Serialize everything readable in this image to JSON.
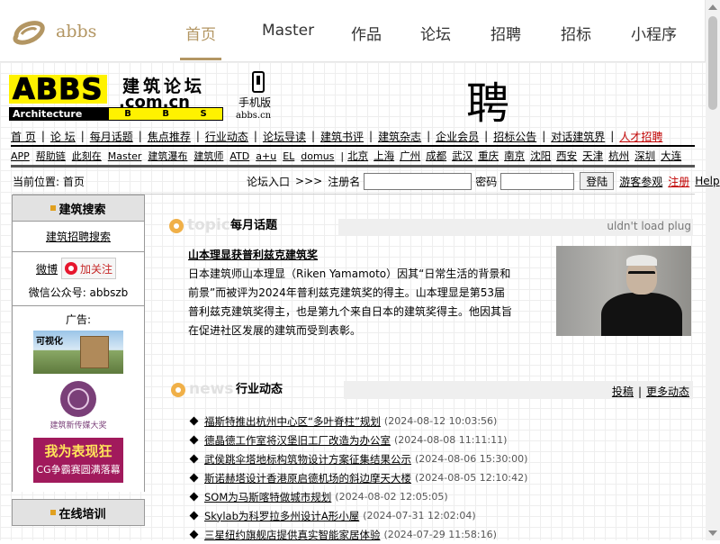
{
  "topnav": {
    "logo_text": "abbs",
    "links": [
      "首页",
      "Master",
      "作品",
      "论坛",
      "招聘",
      "招标",
      "小程序"
    ],
    "active_index": 0
  },
  "banner": {
    "abbs": "ABBS",
    "cn_title": "建筑论坛",
    "domain": ".com.cn",
    "architecture": "Architecture",
    "bbs_letters": [
      "B",
      "B",
      "S"
    ],
    "mobile_label": "手机版",
    "mobile_url": "abbs.cn",
    "page_char": "聘"
  },
  "menu1": [
    "首 页",
    "论 坛",
    "每月话题",
    "焦点推荐",
    "行业动态",
    "论坛导读",
    "建筑书评",
    "建筑杂志",
    "企业会员",
    "招标公告",
    "对话建筑界",
    "人才招聘"
  ],
  "menu2": [
    "APP",
    "帮助链",
    "此刻在",
    "Master",
    "建筑瀑布",
    "建筑师",
    "ATD",
    "a+u",
    "EL",
    "domus"
  ],
  "cities": [
    "北京",
    "上海",
    "广州",
    "成都",
    "武汉",
    "重庆",
    "南京",
    "沈阳",
    "西安",
    "天津",
    "杭州",
    "深圳",
    "大连"
  ],
  "location": "当前位置: 首页",
  "login": {
    "forum_entry": "论坛入口",
    "arrows": ">>>",
    "username_label": "注册名",
    "password_label": "密码",
    "login_button": "登陆",
    "guest": "游客参观",
    "register": "注册",
    "help": "Help"
  },
  "sidebar": {
    "search_title": "建筑搜索",
    "job_search": "建筑招聘搜索",
    "weibo": "微博",
    "follow": "加关注",
    "wechat": "微信公众号: abbszb",
    "ad_label": "广告:",
    "ad1_text": "可视化",
    "ad2_caption": "建筑新传媒大奖",
    "ad3_line1": "我为表现狂",
    "ad3_line2": "CG争霸赛圆满落幕",
    "training_title": "在线培训"
  },
  "topic": {
    "word": "topic",
    "title": "每月话题",
    "plugin_msg": "uldn't load plug",
    "headline": "山本理显获普利兹克建筑奖",
    "body": "日本建筑师山本理显（Riken Yamamoto）因其“日常生活的背景和前景”而被评为2024年普利兹克建筑奖的得主。山本理显是第53届普利兹克建筑奖得主，也是第九个来自日本的建筑奖得主。他因其旨在促进社区发展的建筑而受到表彰。"
  },
  "news": {
    "word": "news",
    "title": "行业动态",
    "submit": "投稿",
    "more": "更多动态",
    "sep": "|",
    "items": [
      {
        "title": "福斯特推出杭州中心区“多叶脊柱”规划",
        "time": "(2024-08-12 10:03:56)"
      },
      {
        "title": "德晶德工作室将汉堡旧工厂改造为办公室",
        "time": "(2024-08-08 11:11:11)"
      },
      {
        "title": "武侯跳伞塔地标构筑物设计方案征集结果公示",
        "time": "(2024-08-06 15:30:00)"
      },
      {
        "title": "斯诺赫塔设计香港原启德机场的斜边摩天大楼",
        "time": "(2024-08-05 12:10:42)"
      },
      {
        "title": "SOM为马斯喀特做城市规划",
        "time": "(2024-08-02 12:05:05)"
      },
      {
        "title": "Skylab为科罗拉多州设计A形小屋",
        "time": "(2024-07-31 12:02:04)"
      },
      {
        "title": "三星纽约旗舰店提供真实智能家居体验",
        "time": "(2024-07-29 11:58:16)"
      }
    ]
  }
}
